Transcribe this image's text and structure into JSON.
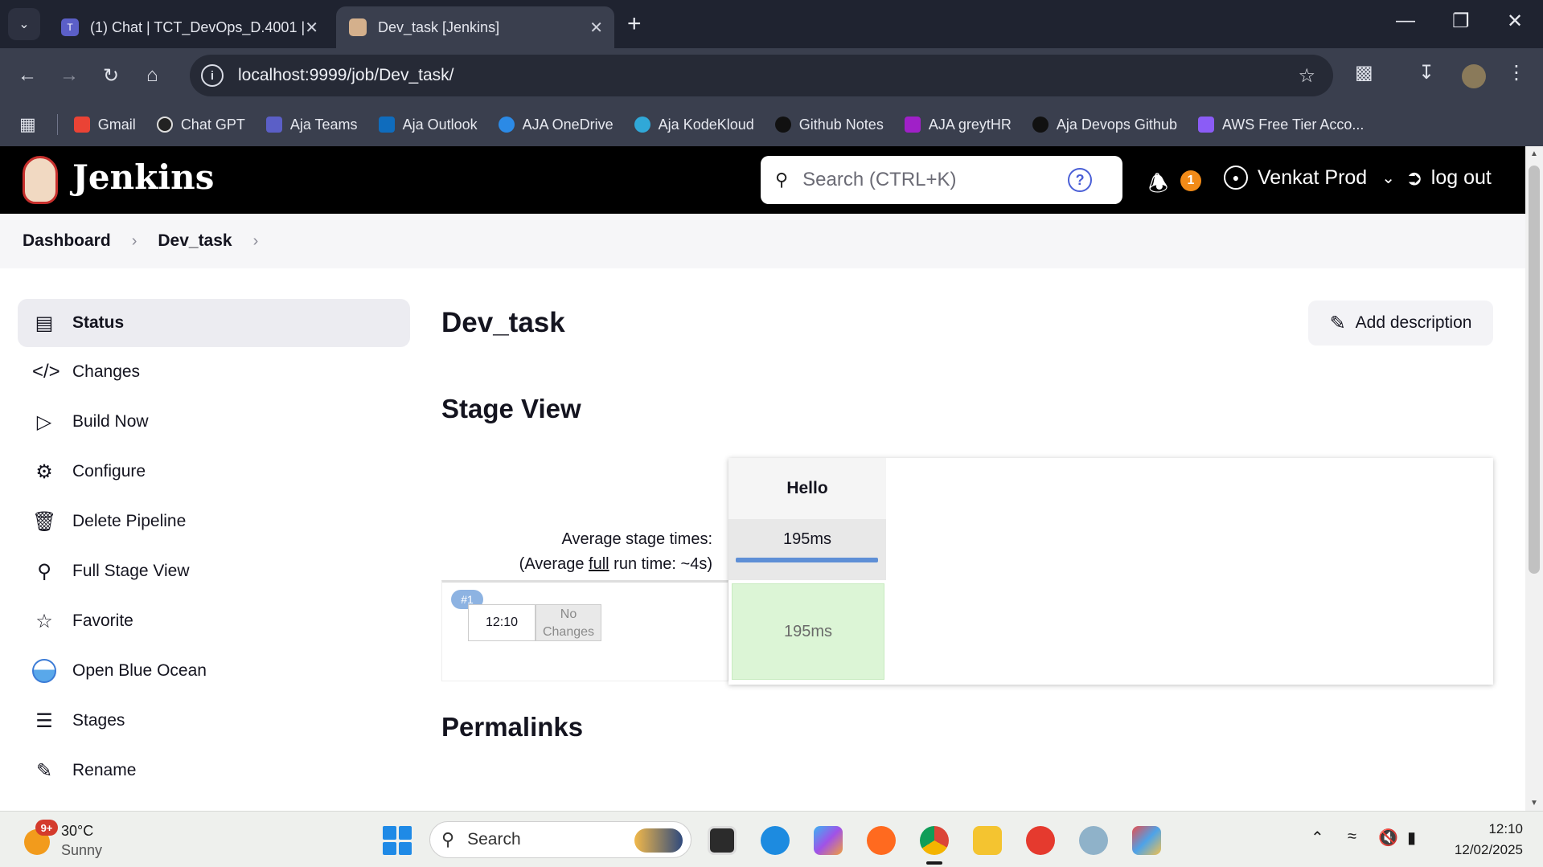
{
  "browser": {
    "tabs": [
      {
        "title": "(1) Chat | TCT_DevOps_D.4001 |",
        "active": false
      },
      {
        "title": "Dev_task [Jenkins]",
        "active": true
      }
    ],
    "url": "localhost:9999/job/Dev_task/",
    "bookmarks": [
      "Gmail",
      "Chat GPT",
      "Aja Teams",
      "Aja Outlook",
      "AJA OneDrive",
      "Aja KodeKloud",
      "Github Notes",
      "AJA greytHR",
      "Aja Devops Github",
      "AWS Free Tier Acco..."
    ]
  },
  "jenkins": {
    "logo_text": "Jenkins",
    "search_placeholder": "Search (CTRL+K)",
    "notification_count": "1",
    "user_name": "Venkat Prod",
    "logout_label": "log out"
  },
  "breadcrumb": [
    "Dashboard",
    "Dev_task"
  ],
  "sidebar": {
    "items": [
      {
        "label": "Status",
        "icon": "document-icon",
        "active": true
      },
      {
        "label": "Changes",
        "icon": "code-icon"
      },
      {
        "label": "Build Now",
        "icon": "play-icon"
      },
      {
        "label": "Configure",
        "icon": "gear-icon"
      },
      {
        "label": "Delete Pipeline",
        "icon": "trash-icon"
      },
      {
        "label": "Full Stage View",
        "icon": "search-icon"
      },
      {
        "label": "Favorite",
        "icon": "star-icon"
      },
      {
        "label": "Open Blue Ocean",
        "icon": "blue-ocean-icon"
      },
      {
        "label": "Stages",
        "icon": "layers-icon"
      },
      {
        "label": "Rename",
        "icon": "pencil-icon"
      }
    ]
  },
  "main": {
    "title": "Dev_task",
    "add_description": "Add description",
    "stage_view_heading": "Stage View",
    "permalinks_heading": "Permalinks",
    "avg_stage_label": "Average stage times:",
    "avg_full_prefix": "(Average ",
    "avg_full_link": "full",
    "avg_full_suffix": " run time: ~4s)",
    "stage": {
      "name": "Hello",
      "avg_time": "195ms",
      "run_time": "195ms"
    },
    "run": {
      "tag": "#1",
      "time": "12:10",
      "changes": "No Changes"
    }
  },
  "taskbar": {
    "weather_temp": "30°C",
    "weather_cond": "Sunny",
    "weather_badge": "9+",
    "search_label": "Search",
    "clock_time": "12:10",
    "clock_date": "12/02/2025"
  },
  "colors": {
    "jenkins_header": "#000000",
    "stage_success": "#dcf5d6",
    "stage_bar": "#5e8fd6",
    "badge": "#f28b18"
  }
}
